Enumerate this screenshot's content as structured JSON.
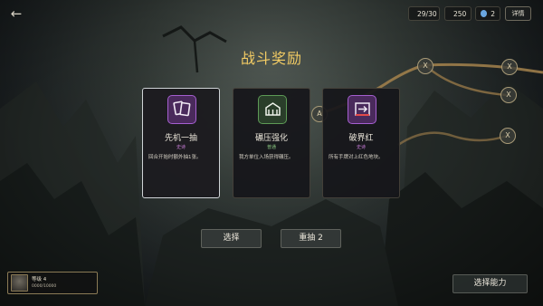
{
  "topbar": {
    "back_icon": "arrow-left-icon",
    "hp": "29/30",
    "gold": "250",
    "gems": "2",
    "detail_label": "详情",
    "colors": {
      "hp": "#d64a4a",
      "gold": "#d7b15b",
      "gem": "#6aa6e0"
    }
  },
  "map": {
    "nodes": [
      {
        "label": "X",
        "sub": ""
      },
      {
        "label": "X",
        "sub": ""
      },
      {
        "label": "X",
        "sub": ""
      },
      {
        "label": "X",
        "sub": ""
      },
      {
        "label": "A",
        "sub": ""
      }
    ]
  },
  "reward": {
    "title": "战斗奖励",
    "cards": [
      {
        "name": "先机一抽",
        "rarity": "史诗",
        "rarity_color": "#c77bd6",
        "description": "回合开始时额外抽1张。",
        "icon": "cards-icon",
        "icon_color": "#a55fd0",
        "selected": true
      },
      {
        "name": "碾压强化",
        "rarity": "普通",
        "rarity_color": "#8ac880",
        "description": "我方单位入场获得碾压。",
        "icon": "fortress-icon",
        "icon_color": "#5d9a56",
        "selected": false
      },
      {
        "name": "破界红",
        "rarity": "史诗",
        "rarity_color": "#c77bd6",
        "description": "所有手牌对上红色地块。",
        "icon": "arrow-box-icon",
        "icon_color": "#a55fd0",
        "selected": false
      }
    ],
    "select_label": "选择",
    "reroll_label": "重抽 2"
  },
  "player": {
    "level": "等级 4",
    "xp": "0000/10000"
  },
  "ability_label": "选择能力"
}
